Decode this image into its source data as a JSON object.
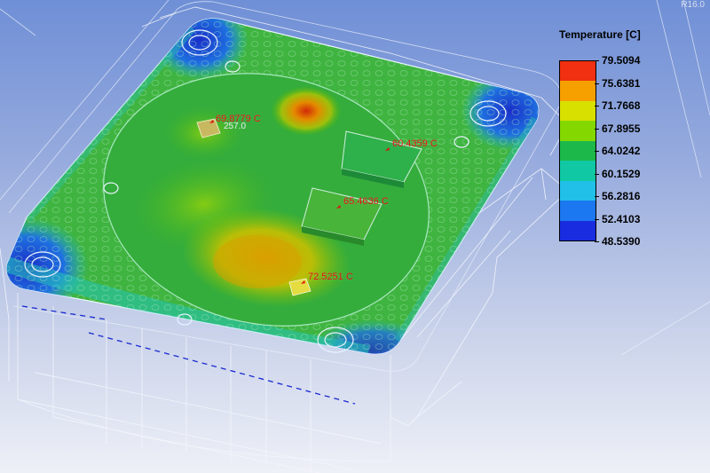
{
  "viewport": {
    "view_tag": "R16.0",
    "probes": [
      {
        "id": "probe-1",
        "label": "69.8779 C",
        "secondary": "257.0"
      },
      {
        "id": "probe-2",
        "label": "60.4359 C"
      },
      {
        "id": "probe-3",
        "label": "65.4636 C"
      },
      {
        "id": "probe-4",
        "label": "72.5251 C"
      }
    ]
  },
  "legend": {
    "title": "Temperature [C]",
    "values": [
      "79.5094",
      "75.6381",
      "71.7668",
      "67.8955",
      "64.0242",
      "60.1529",
      "56.2816",
      "52.4103",
      "48.5390"
    ],
    "band_colors": [
      "#f03010",
      "#f6a000",
      "#d8e000",
      "#84d800",
      "#1cb84a",
      "#10c8a4",
      "#20c0e8",
      "#1c78f0",
      "#1a2ce0"
    ]
  },
  "colors": {
    "background_top": "#6f8fd6",
    "background_bottom": "#eef0f7",
    "probe_label": "#e01010"
  }
}
